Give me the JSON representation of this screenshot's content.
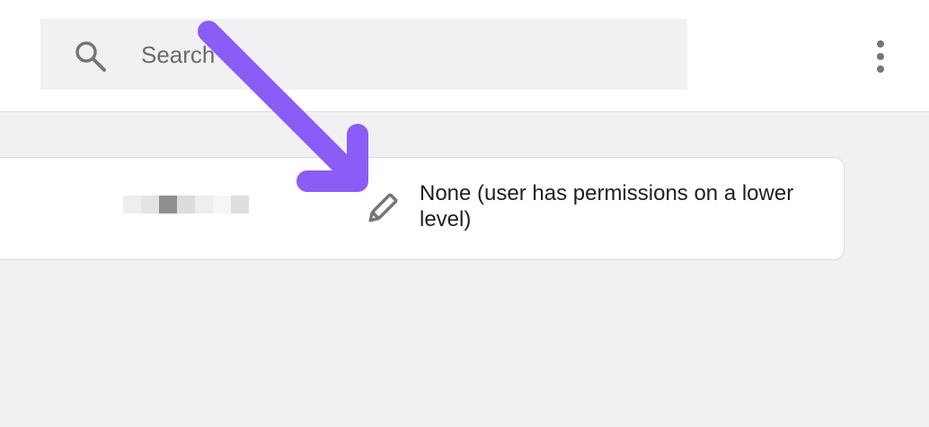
{
  "search": {
    "placeholder": "Search",
    "icon": "search-icon"
  },
  "menu": {
    "icon": "more-vertical-icon"
  },
  "row": {
    "edit_icon": "pencil-icon",
    "access_label": "None (user has permissions on a lower level)"
  },
  "colors": {
    "arrow": "#8b5cf6",
    "icon": "#757575",
    "text": "#1f1f1f",
    "panel": "#f1f1f3"
  }
}
